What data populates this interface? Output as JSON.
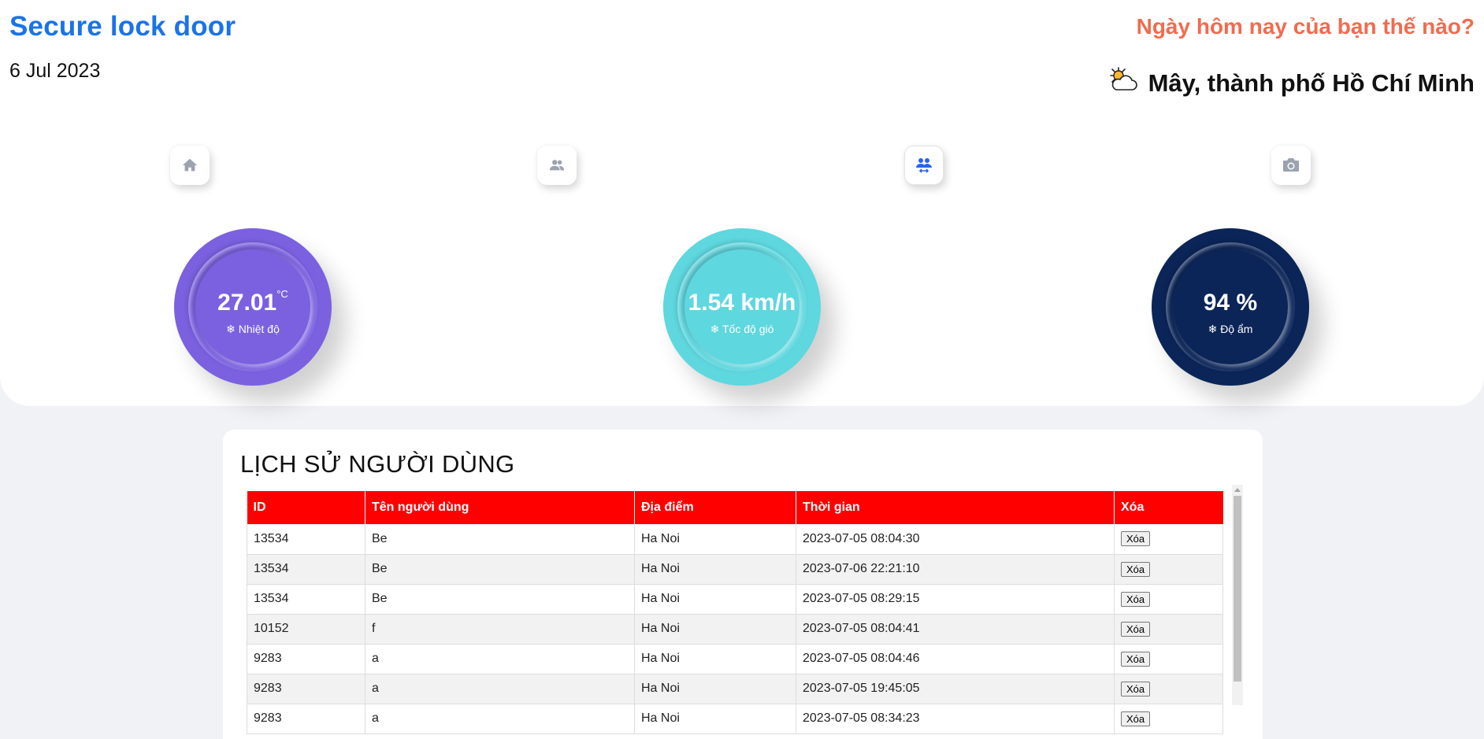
{
  "header": {
    "app_title": "Secure lock door",
    "date": "6 Jul 2023",
    "greeting": "Ngày hôm nay của bạn thế nào?",
    "weather_text": "Mây, thành phố Hồ Chí Minh",
    "weather_icon": "cloud-sun-icon"
  },
  "nav": {
    "items": [
      {
        "icon": "home-icon"
      },
      {
        "icon": "users-icon"
      },
      {
        "icon": "user-transfer-icon",
        "active": true
      },
      {
        "icon": "camera-icon"
      }
    ]
  },
  "gauges": [
    {
      "value": "27.01",
      "unit": "°C",
      "label": "Nhiệt độ",
      "color": "#7b61e0"
    },
    {
      "value": "1.54 km/h",
      "unit": "",
      "label": "Tốc độ gió",
      "color": "#5fd7df"
    },
    {
      "value": "94 %",
      "unit": "",
      "label": "Độ ẩm",
      "color": "#0b2558"
    }
  ],
  "history": {
    "title": "LỊCH SỬ NGƯỜI DÙNG",
    "columns": [
      "ID",
      "Tên người dùng",
      "Địa điểm",
      "Thời gian",
      "Xóa"
    ],
    "delete_label": "Xóa",
    "rows": [
      {
        "id": "13534",
        "name": "Be",
        "location": "Ha Noi",
        "time": "2023-07-05 08:04:30"
      },
      {
        "id": "13534",
        "name": "Be",
        "location": "Ha Noi",
        "time": "2023-07-06 22:21:10"
      },
      {
        "id": "13534",
        "name": "Be",
        "location": "Ha Noi",
        "time": "2023-07-05 08:29:15"
      },
      {
        "id": "10152",
        "name": "f",
        "location": "Ha Noi",
        "time": "2023-07-05 08:04:41"
      },
      {
        "id": "9283",
        "name": "a",
        "location": "Ha Noi",
        "time": "2023-07-05 08:04:46"
      },
      {
        "id": "9283",
        "name": "a",
        "location": "Ha Noi",
        "time": "2023-07-05 19:45:05"
      },
      {
        "id": "9283",
        "name": "a",
        "location": "Ha Noi",
        "time": "2023-07-05 08:34:23"
      }
    ]
  },
  "colors": {
    "title_blue": "#1a73e8",
    "greeting_orange": "#f26b4f",
    "table_header_red": "#ff0000",
    "active_icon_blue": "#2563eb",
    "icon_gray": "#9ca3af"
  }
}
